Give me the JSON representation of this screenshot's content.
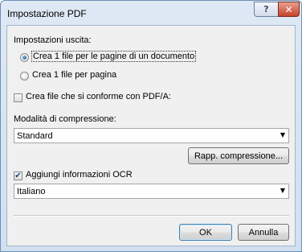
{
  "window": {
    "title": "Impostazione PDF",
    "help_glyph": "?",
    "close_glyph": "✕"
  },
  "output": {
    "heading": "Impostazioni uscita:",
    "options": [
      {
        "label": "Crea 1 file per le pagine di un documento",
        "selected": true
      },
      {
        "label": "Crea 1 file per pagina",
        "selected": false
      }
    ]
  },
  "pdfa": {
    "label": "Crea file che si conforme con PDF/A:",
    "checked": false
  },
  "compression": {
    "label": "Modalità di compressione:",
    "selected": "Standard",
    "ratio_button": "Rapp. compressione..."
  },
  "ocr": {
    "label": "Aggiungi informazioni OCR",
    "checked": true,
    "language": "Italiano"
  },
  "buttons": {
    "ok": "OK",
    "cancel": "Annulla"
  },
  "icons": {
    "dropdown": "chevron-down-icon",
    "check": "checkmark-icon"
  }
}
